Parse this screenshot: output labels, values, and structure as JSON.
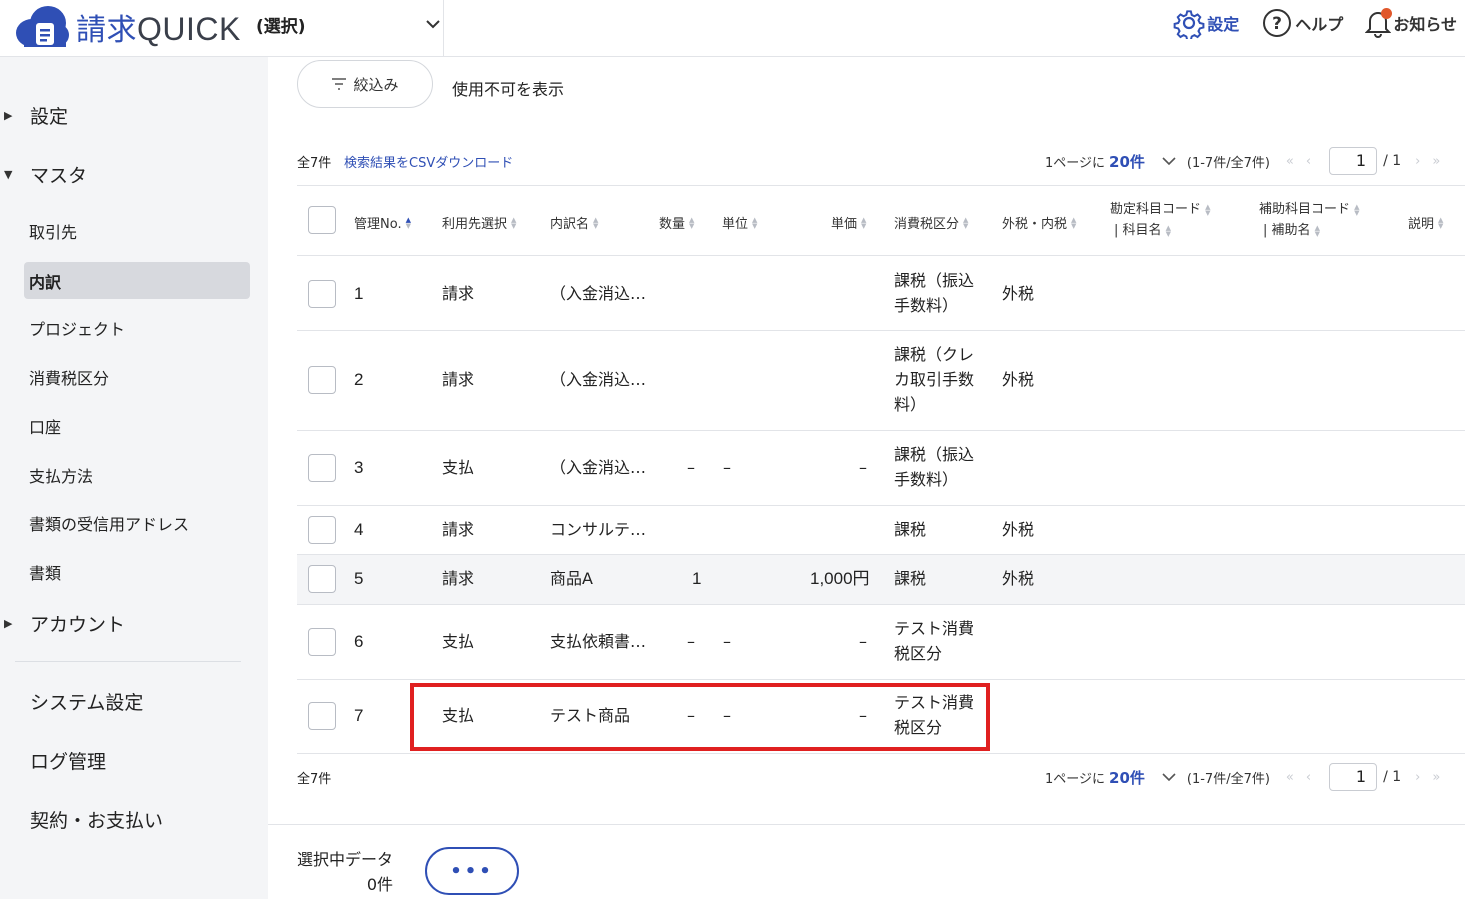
{
  "app": {
    "name_kanji": "請求",
    "name_latin": "QUICK",
    "org_select": "(選択)"
  },
  "header": {
    "settings": "設定",
    "help": "ヘルプ",
    "notices": "お知らせ"
  },
  "sidebar": {
    "sections": [
      "設定",
      "マスタ",
      "アカウント"
    ],
    "items": [
      "取引先",
      "内訳",
      "プロジェクト",
      "消費税区分",
      "口座",
      "支払方法",
      "書類の受信用アドレス",
      "書類"
    ],
    "active": "内訳",
    "bottom": [
      "システム設定",
      "ログ管理",
      "契約・お支払い"
    ]
  },
  "toolbar": {
    "filter": "絞込み",
    "show_disabled": "使用不可を表示"
  },
  "list": {
    "total": "全7件",
    "csv": "検索結果をCSVダウンロード",
    "per_page_label": "1ページに",
    "per_page_value": "20件",
    "range": "(1-7件/全7件)",
    "page": "1",
    "page_total": "/ 1"
  },
  "table": {
    "headers": {
      "no": "管理No.",
      "target": "利用先選択",
      "name": "内訳名",
      "qty": "数量",
      "unit": "単位",
      "price": "単価",
      "tax": "消費税区分",
      "taxtype": "外税・内税",
      "acct1": "勘定科目コード",
      "acct2": "| 科目名",
      "sub1": "補助科目コード",
      "sub2": "| 補助名",
      "desc": "説明"
    },
    "rows": [
      {
        "no": "1",
        "target": "請求",
        "name": "（入金消込…",
        "qty": "",
        "unit": "",
        "price": "",
        "tax": "課税（振込手数料）",
        "taxtype": "外税"
      },
      {
        "no": "2",
        "target": "請求",
        "name": "（入金消込…",
        "qty": "",
        "unit": "",
        "price": "",
        "tax": "課税（クレカ取引手数料）",
        "taxtype": "外税"
      },
      {
        "no": "3",
        "target": "支払",
        "name": "（入金消込…",
        "qty": "–",
        "unit": "–",
        "price": "–",
        "tax": "課税（振込手数料）",
        "taxtype": ""
      },
      {
        "no": "4",
        "target": "請求",
        "name": "コンサルテ…",
        "qty": "",
        "unit": "",
        "price": "",
        "tax": "課税",
        "taxtype": "外税"
      },
      {
        "no": "5",
        "target": "請求",
        "name": "商品A",
        "qty": "1",
        "unit": "",
        "price": "1,000円",
        "tax": "課税",
        "taxtype": "外税"
      },
      {
        "no": "6",
        "target": "支払",
        "name": "支払依頼書…",
        "qty": "–",
        "unit": "–",
        "price": "–",
        "tax": "テスト消費税区分",
        "taxtype": ""
      },
      {
        "no": "7",
        "target": "支払",
        "name": "テスト商品",
        "qty": "–",
        "unit": "–",
        "price": "–",
        "tax": "テスト消費税区分",
        "taxtype": ""
      }
    ]
  },
  "selection": {
    "label": "選択中データ",
    "count": "0件",
    "more": "•••"
  },
  "colors": {
    "brand": "#2f4fb5",
    "highlight": "#e02020",
    "notice_dot": "#e0572b"
  }
}
